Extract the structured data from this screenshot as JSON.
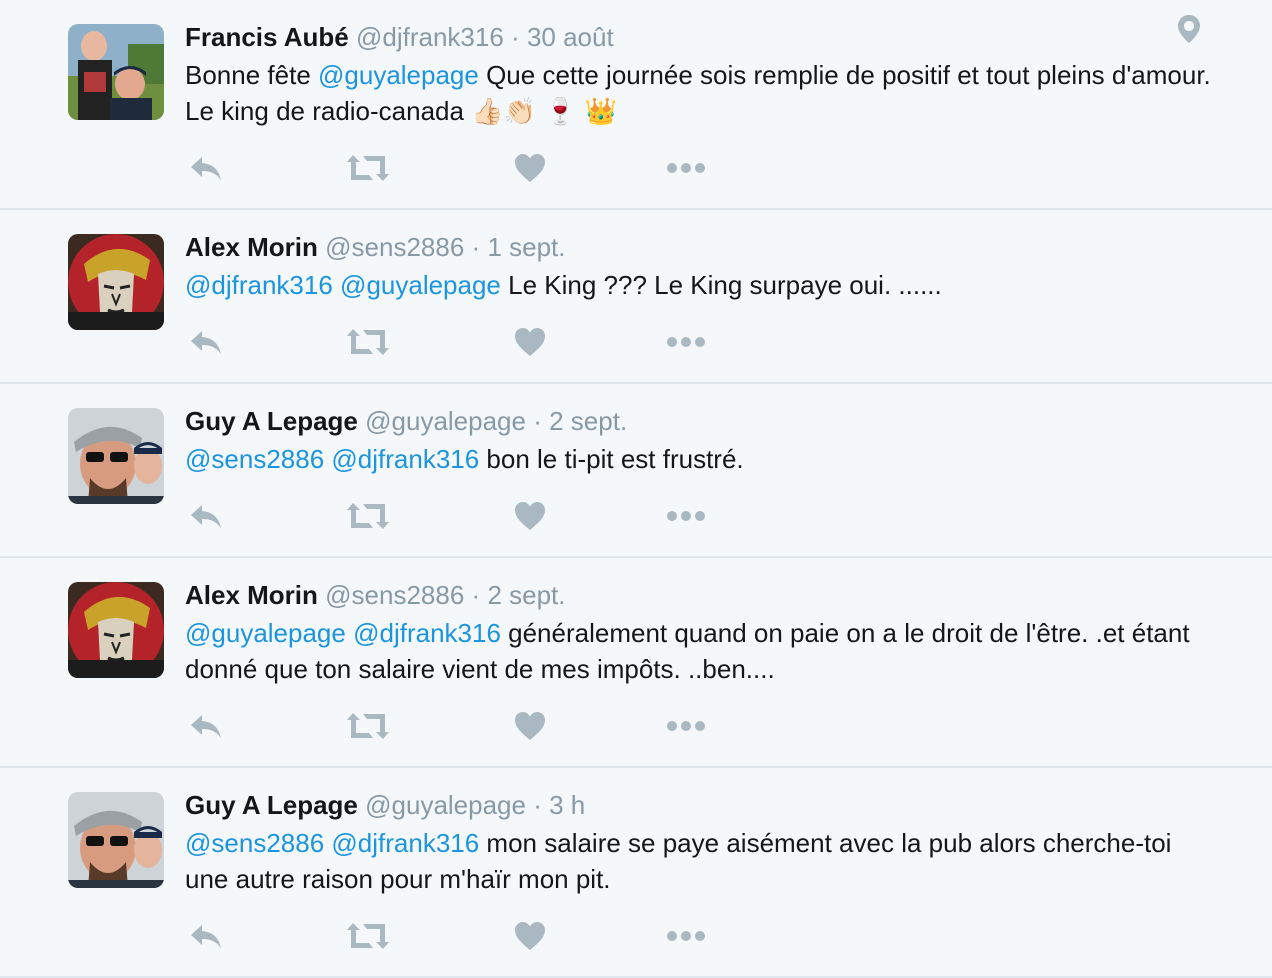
{
  "colors": {
    "mention": "#1b95e0",
    "muted": "#8899a6",
    "action_icon": "#aab8c2",
    "background": "#f5f8fa",
    "divider": "#e1e8ed"
  },
  "tweets": [
    {
      "name": "Francis Aubé",
      "handle": "@djfrank316",
      "sep": "·",
      "time": "30 août",
      "avatar": "photo-boy-and-man-icon",
      "body": [
        {
          "t": "Bonne fête "
        },
        {
          "m": "@guyalepage"
        },
        {
          "t": "  Que cette journée sois remplie de positif et tout pleins d'amour. Le king de radio-canada "
        },
        {
          "e": "👍🏻👏🏻 🍷 👑"
        }
      ]
    },
    {
      "name": "Alex Morin",
      "handle": "@sens2886",
      "sep": "·",
      "time": "1 sept.",
      "avatar": "ottawa-senators-logo-icon",
      "body": [
        {
          "m": "@djfrank316"
        },
        {
          "t": " "
        },
        {
          "m": "@guyalepage"
        },
        {
          "t": " Le King ??? Le King surpaye oui. ......"
        }
      ]
    },
    {
      "name": "Guy A Lepage",
      "handle": "@guyalepage",
      "sep": "·",
      "time": "2 sept.",
      "avatar": "selfie-man-with-cap-icon",
      "body": [
        {
          "m": "@sens2886"
        },
        {
          "t": " "
        },
        {
          "m": "@djfrank316"
        },
        {
          "t": " bon le ti-pit est frustré."
        }
      ]
    },
    {
      "name": "Alex Morin",
      "handle": "@sens2886",
      "sep": "·",
      "time": "2 sept.",
      "avatar": "ottawa-senators-logo-icon",
      "body": [
        {
          "m": "@guyalepage"
        },
        {
          "t": " "
        },
        {
          "m": "@djfrank316"
        },
        {
          "t": " généralement quand on paie on a le droit de l'être. .et étant donné que ton salaire vient de mes impôts. ..ben...."
        }
      ]
    },
    {
      "name": "Guy A Lepage",
      "handle": "@guyalepage",
      "sep": "·",
      "time": "3 h",
      "avatar": "selfie-man-with-cap-icon",
      "body": [
        {
          "m": "@sens2886"
        },
        {
          "t": " "
        },
        {
          "m": "@djfrank316"
        },
        {
          "t": " mon salaire se paye aisément avec la pub alors cherche-toi une autre raison pour m'haïr mon pit."
        }
      ]
    }
  ],
  "actions": [
    "reply-icon",
    "retweet-icon",
    "like-icon",
    "more-icon"
  ],
  "location_icon": "location-pin-icon"
}
